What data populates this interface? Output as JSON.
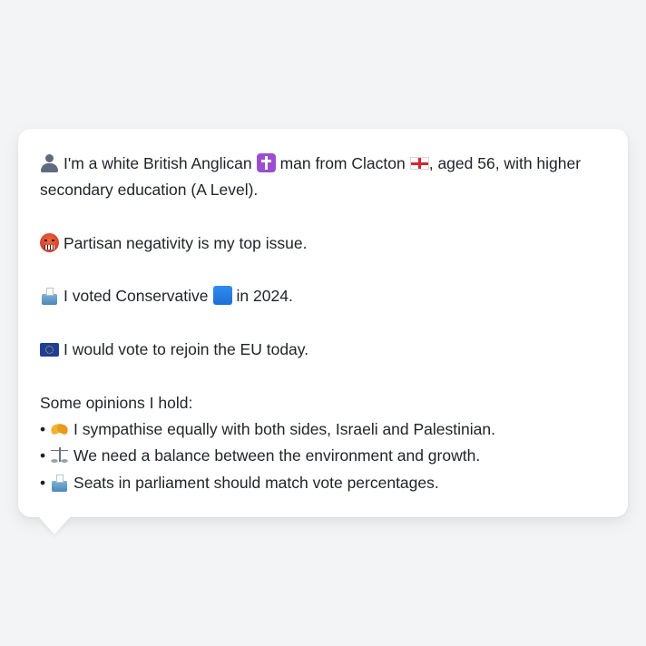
{
  "profile": {
    "icons": {
      "person": "person-silhouette-icon",
      "religion": "latin-cross-icon",
      "region": "england-flag-icon",
      "issue": "angry-face-icon",
      "vote": "ballot-box-icon",
      "party": "blue-square-icon",
      "eu": "eu-flag-icon"
    },
    "identity_part1": "I'm a white British Anglican",
    "identity_part2": "man from Clacton",
    "identity_part3": ", aged 56, with higher",
    "identity_line2": "secondary education (A Level).",
    "top_issue": "Partisan negativity is my top issue.",
    "vote_part1": "I voted Conservative",
    "vote_part2": "in 2024.",
    "eu_stance": "I would vote to rejoin the EU today.",
    "opinions_heading": "Some opinions I hold:",
    "opinions": [
      {
        "bullet": "•",
        "icon": "handshake-icon",
        "text": "I sympathise equally with both sides, Israeli and Palestinian."
      },
      {
        "bullet": "•",
        "icon": "balance-scale-icon",
        "text": "We need a balance between the environment and growth."
      },
      {
        "bullet": "•",
        "icon": "ballot-box-icon",
        "text": "Seats in parliament should match vote percentages."
      }
    ]
  },
  "colors": {
    "background": "#f3f4f6",
    "card": "#ffffff",
    "text": "#1f2328",
    "party_blue": "#1d6fd6"
  }
}
